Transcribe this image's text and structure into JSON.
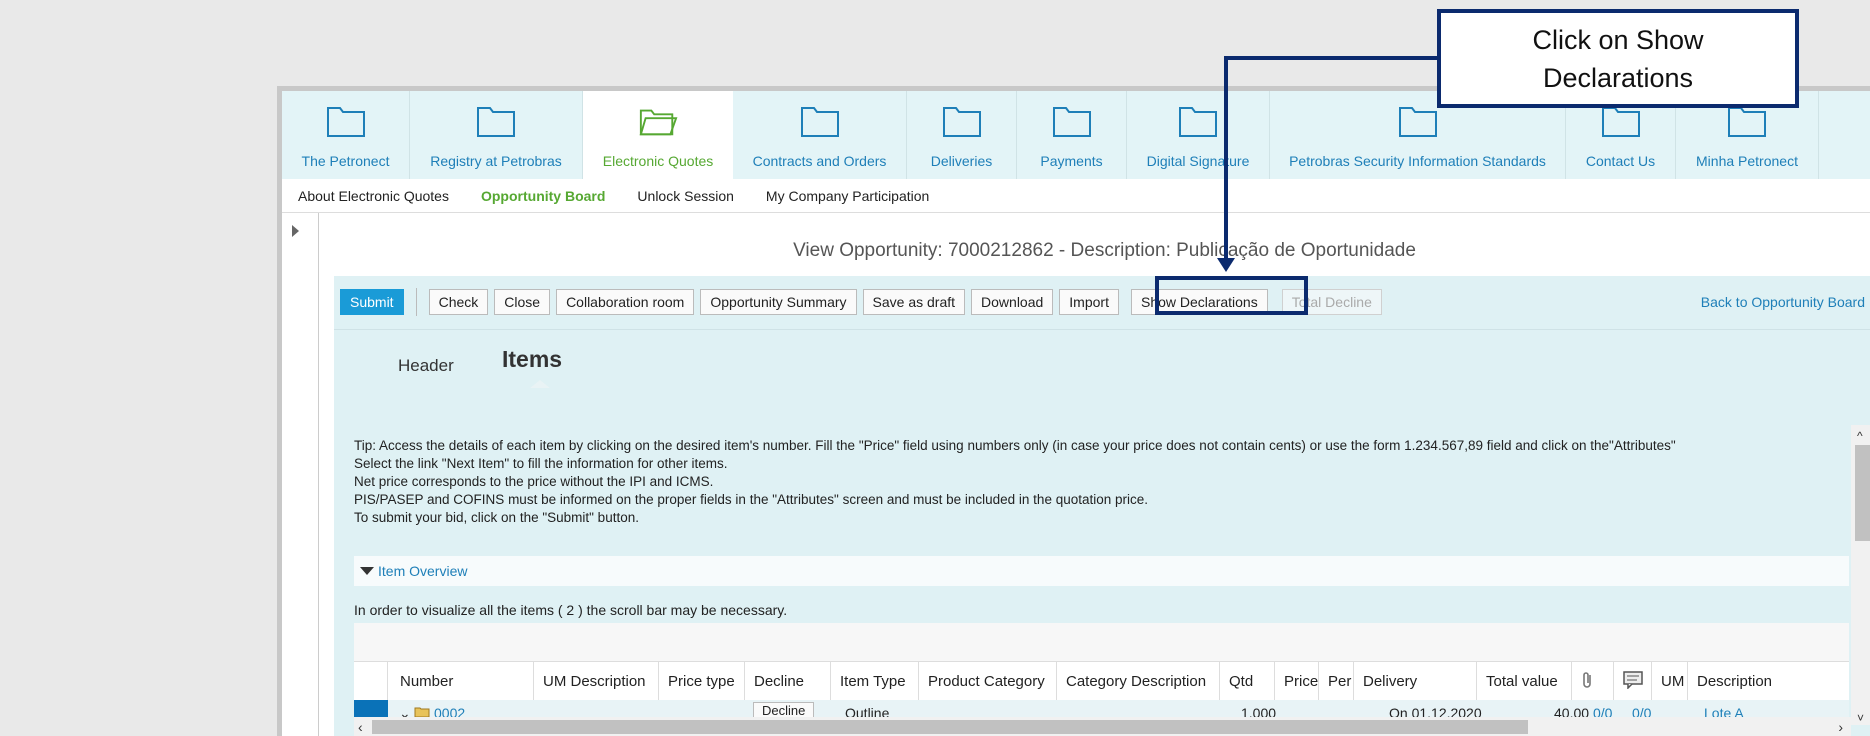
{
  "topnav": {
    "items": [
      {
        "label": "The Petronect"
      },
      {
        "label": "Registry at Petrobras"
      },
      {
        "label": "Electronic Quotes"
      },
      {
        "label": "Contracts and Orders"
      },
      {
        "label": "Deliveries"
      },
      {
        "label": "Payments"
      },
      {
        "label": "Digital Signature"
      },
      {
        "label": "Petrobras Security Information Standards"
      },
      {
        "label": "Contact Us"
      },
      {
        "label": "Minha Petronect"
      }
    ],
    "active_index": 2,
    "icon_color": "#1e7fb8",
    "active_color": "#56a832"
  },
  "subnav": {
    "items": [
      {
        "label": "About Electronic Quotes"
      },
      {
        "label": "Opportunity Board"
      },
      {
        "label": "Unlock Session"
      },
      {
        "label": "My Company Participation"
      }
    ]
  },
  "page": {
    "title": "View Opportunity: 7000212862 - Description: Publicação de Oportunidade"
  },
  "toolbar": {
    "submit": "Submit",
    "check": "Check",
    "close": "Close",
    "collab": "Collaboration room",
    "summary": "Opportunity Summary",
    "save_draft": "Save as draft",
    "download": "Download",
    "import": "Import",
    "show_decl": "Show Declarations",
    "total_decline": "Total Decline",
    "back": "Back to Opportunity Board"
  },
  "tabs": {
    "header": "Header",
    "items": "Items"
  },
  "tip": {
    "lines": [
      "Tip: Access the details of each item by clicking on the desired item's number. Fill the \"Price\" field using numbers only (in case your price does not contain cents) or use the form 1.234.567,89 field and click on the\"Attributes\"",
      "Select the link \"Next Item\" to fill the information for other items.",
      "Net price corresponds to the price without the IPI and ICMS.",
      "PIS/PASEP and COFINS must be informed on the proper fields in the \"Attributes\" screen and must be included in the quotation price.",
      "To submit your bid, click on the \"Submit\" button."
    ]
  },
  "overview": {
    "label": "Item Overview",
    "note": "In order to visualize all the items ( 2 ) the scroll bar may be necessary."
  },
  "table": {
    "headers": [
      "Number",
      "UM Description",
      "Price type",
      "Decline",
      "Item Type",
      "Product Category",
      "Category Description",
      "Qtd",
      "Price",
      "Per",
      "Delivery",
      "Total value",
      "",
      "",
      "UM",
      "Description"
    ],
    "row": {
      "number": "0002",
      "decline": "Decline",
      "item_type": "Outline",
      "qtd": "1.000",
      "delivery": "On 01.12.2020",
      "total": "40.00",
      "att": "0/0",
      "notes": "0/0",
      "description": "Lote A"
    }
  },
  "callout": {
    "line1": "Click on Show",
    "line2": "Declarations",
    "color": "#0b2a6e"
  }
}
